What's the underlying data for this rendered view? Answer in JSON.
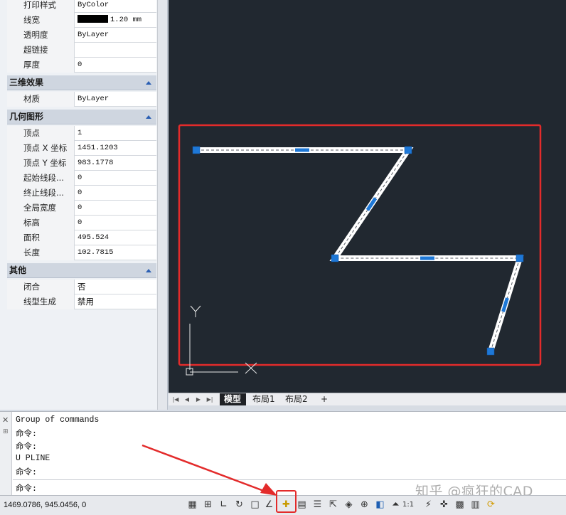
{
  "properties": {
    "rows_general": [
      {
        "key": "打印样式",
        "value": "ByColor"
      },
      {
        "key": "线宽",
        "value": "1.20 mm",
        "swatch": true
      },
      {
        "key": "透明度",
        "value": "ByLayer"
      },
      {
        "key": "超链接",
        "value": ""
      },
      {
        "key": "厚度",
        "value": "0"
      }
    ],
    "section_3d": {
      "title": "三维效果",
      "rows": [
        {
          "key": "材质",
          "value": "ByLayer"
        }
      ]
    },
    "section_geometry": {
      "title": "几何图形",
      "rows": [
        {
          "key": "顶点",
          "value": "1"
        },
        {
          "key": "顶点 X 坐标",
          "value": "1451.1203"
        },
        {
          "key": "顶点 Y 坐标",
          "value": "983.1778"
        },
        {
          "key": "起始线段...",
          "value": "0"
        },
        {
          "key": "终止线段...",
          "value": "0"
        },
        {
          "key": "全局宽度",
          "value": "0"
        },
        {
          "key": "标高",
          "value": "0"
        },
        {
          "key": "面积",
          "value": "495.524"
        },
        {
          "key": "长度",
          "value": "102.7815"
        }
      ]
    },
    "section_misc": {
      "title": "其他",
      "rows": [
        {
          "key": "闭合",
          "value": "否"
        },
        {
          "key": "线型生成",
          "value": "禁用"
        }
      ]
    }
  },
  "canvas": {
    "background": "#212830",
    "ucs_y_label": "Y",
    "ucs_x_label": "X",
    "highlight_color": "#e32b2b",
    "grip_color": "#1e78d7"
  },
  "tabs": {
    "model": "模型",
    "layout1": "布局1",
    "layout2": "布局2",
    "add": "+"
  },
  "command": {
    "history": [
      "Group of commands",
      "命令:",
      "命令:",
      "U PLINE",
      "命令:"
    ],
    "prompt": "命令:"
  },
  "status": {
    "coords": "1469.0786, 945.0456, 0",
    "scale": "1:1"
  },
  "watermark": "知乎 @疯狂的CAD"
}
